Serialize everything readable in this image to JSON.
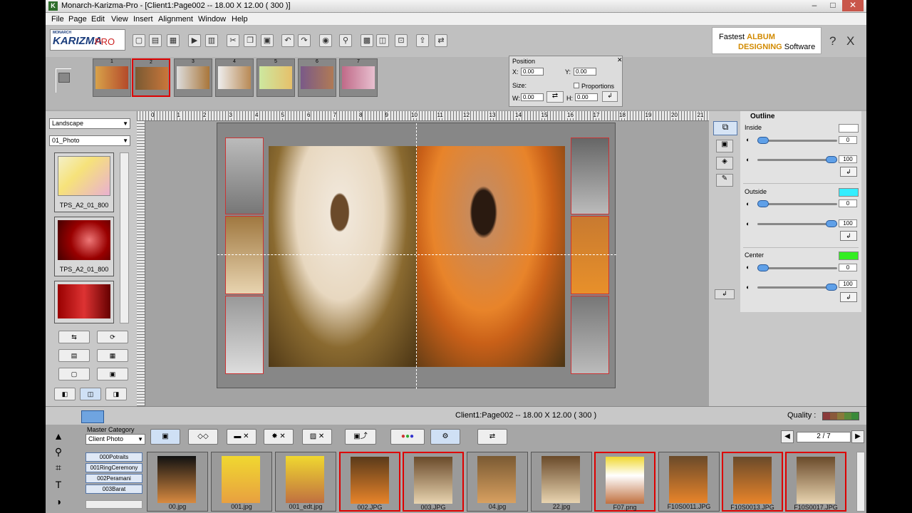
{
  "window": {
    "title": "Monarch-Karizma-Pro - [Client1:Page002 -- 18.00 X 12.00 ( 300 )]",
    "app_icon": "K",
    "controls": [
      "–",
      "□",
      "✕"
    ]
  },
  "menu": [
    "File",
    "Page",
    "Edit",
    "View",
    "Insert",
    "Alignment",
    "Window",
    "Help"
  ],
  "logo": {
    "top": "MONARCH",
    "main": "KARIZMA",
    "pro": "PRO"
  },
  "tagline": {
    "prefix": "Fastest",
    "album": "ALBUM",
    "designing": "DESIGNING",
    "suffix": "Software"
  },
  "topbar_right": {
    "help": "?",
    "close": "X"
  },
  "page_thumbs": [
    "1",
    "2",
    "3",
    "4",
    "5",
    "6",
    "7"
  ],
  "position": {
    "title": "Position",
    "x_label": "X:",
    "x": "0.00",
    "y_label": "Y:",
    "y": "0.00",
    "size_label": "Size:",
    "proportions": "Proportions",
    "w_label": "W:",
    "w": "0.00",
    "h_label": "H:",
    "h": "0.00"
  },
  "left": {
    "orientation": "Landscape",
    "photo_set": "01_Photo",
    "templates": [
      "TPS_A2_01_800",
      "TPS_A2_01_800",
      ""
    ]
  },
  "outline": {
    "title": "Outline",
    "inside": {
      "label": "Inside",
      "v1": "0",
      "v2": "100",
      "color": "#ffffff"
    },
    "outside": {
      "label": "Outside",
      "v1": "0",
      "v2": "100",
      "color": "#33eeff"
    },
    "center": {
      "label": "Center",
      "v1": "0",
      "v2": "100",
      "color": "#33ee22"
    }
  },
  "status": {
    "page_info": "Client1:Page002 -- 18.00 X 12.00 ( 300 )",
    "quality_label": "Quality :"
  },
  "bottom": {
    "master_category_label": "Master Category",
    "master_category_value": "Client Photo",
    "categories": [
      "000Potraits",
      "001RingCeremony",
      "002Peramani",
      "003Barat"
    ],
    "pager": "2 / 7",
    "files": [
      "00.jpg",
      "001.jpg",
      "001_edt.jpg",
      "002.JPG",
      "003.JPG",
      "04.jpg",
      "22.jpg",
      "F07.png",
      "F10S0011.JPG",
      "F10S0013.JPG",
      "F10S0017.JPG"
    ]
  },
  "ruler_numbers": [
    "0",
    "1",
    "2",
    "3",
    "4",
    "5",
    "6",
    "7",
    "8",
    "9",
    "10",
    "11",
    "12",
    "13",
    "14",
    "15",
    "16",
    "17",
    "18",
    "19",
    "20",
    "21"
  ],
  "colors": {
    "accent": "#d00000",
    "selection": "#5fa0e8"
  }
}
